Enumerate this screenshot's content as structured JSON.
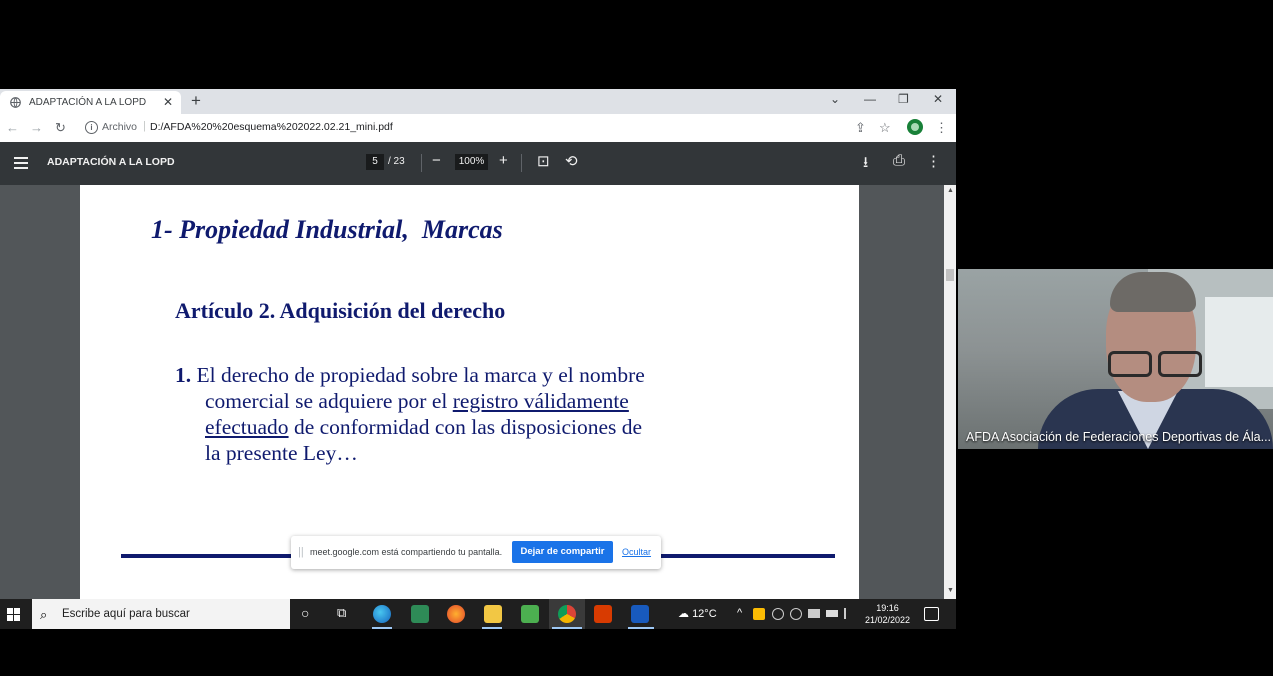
{
  "browser": {
    "tab": {
      "title": "ADAPTACIÓN A LA LOPD",
      "close": "✕"
    },
    "new_tab": "+",
    "window_controls": {
      "tab_search": "⌄",
      "minimize": "—",
      "restore": "❐",
      "close": "✕"
    },
    "nav": {
      "back": "←",
      "forward": "→",
      "reload": "↻"
    },
    "address": {
      "scheme": "Archivo",
      "separator": "|",
      "url": "D:/AFDA%20%20esquema%202022.02.21_mini.pdf"
    },
    "toolbar_icons": {
      "share": "⇪",
      "bookmark": "☆",
      "menu": "⋮"
    }
  },
  "pdf_viewer": {
    "title": "ADAPTACIÓN A LA LOPD",
    "current_page": "5",
    "total_pages": "/ 23",
    "zoom": "100%",
    "icons": {
      "zoom_out": "−",
      "zoom_in": "+",
      "fit": "⊡",
      "rotate": "⟲",
      "download": "⭳",
      "print": "⎙",
      "more": "⋮"
    }
  },
  "document": {
    "slide_title": "1- Propiedad Industrial,  Marcas",
    "article_title": "Artículo 2. Adquisición del derecho",
    "paragraph": {
      "number": "1.",
      "line1": " El derecho de propiedad sobre la marca y el nombre",
      "line2_a": "comercial se adquiere por el ",
      "line2_u": "registro válidamente",
      "line3_u": "efectuado",
      "line3_b": " de conformidad con las disposiciones de",
      "line4": "la presente Ley…"
    }
  },
  "share_banner": {
    "grip": "||",
    "message": "meet.google.com está compartiendo tu pantalla.",
    "stop_label": "Dejar de compartir",
    "hide_label": "Ocultar"
  },
  "taskbar": {
    "search_placeholder": "Escribe aquí para buscar",
    "search_icon": "⌕",
    "cortana": "○",
    "task_view": "⧉",
    "weather": {
      "icon": "☁",
      "temp": "12°C"
    },
    "tray_chevron": "^",
    "clock": {
      "time": "19:16",
      "date": "21/02/2022"
    }
  },
  "video_tile": {
    "participant_name": "AFDA Asociación de Federaciones Deportivas de Ála..."
  },
  "colors": {
    "slide_text": "#0f1a6e",
    "pdf_toolbar": "#323639",
    "share_button": "#1a73e8"
  }
}
